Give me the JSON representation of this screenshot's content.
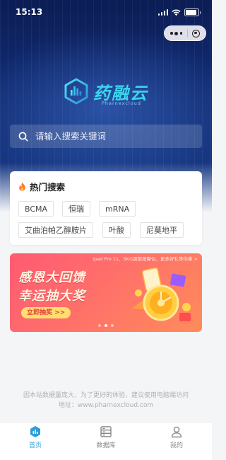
{
  "status_bar": {
    "time": "15:13"
  },
  "brand": {
    "name_cn": "药融云",
    "name_en": "Pharnexcloud"
  },
  "search": {
    "placeholder": "请输入搜索关键词"
  },
  "hot_search": {
    "title": "热门搜索",
    "tags": [
      "BCMA",
      "恒瑞",
      "mRNA",
      "艾曲泊帕乙醇胺片",
      "叶酸",
      "尼莫地平"
    ]
  },
  "banner": {
    "ticker": "ipad Pro 11、SKG颈部按摩仪、更多好礼等你拿 >",
    "title_line1": "感恩大回馈",
    "title_line2": "幸运抽大奖",
    "button": "立即抽奖 >>",
    "slide_count": 3,
    "active_slide": 2
  },
  "notice": {
    "line1": "因本站数据量庞大，为了更好的体验，建议使用电脑端访问",
    "line2": "地址：www.pharnexcloud.com"
  },
  "tabbar": {
    "items": [
      {
        "label": "首页",
        "icon": "home-icon",
        "active": true
      },
      {
        "label": "数据库",
        "icon": "database-icon",
        "active": false
      },
      {
        "label": "我的",
        "icon": "user-icon",
        "active": false
      }
    ]
  },
  "colors": {
    "accent": "#2a9fd8",
    "hero": "#10296e",
    "banner": "#ff6f6a"
  }
}
